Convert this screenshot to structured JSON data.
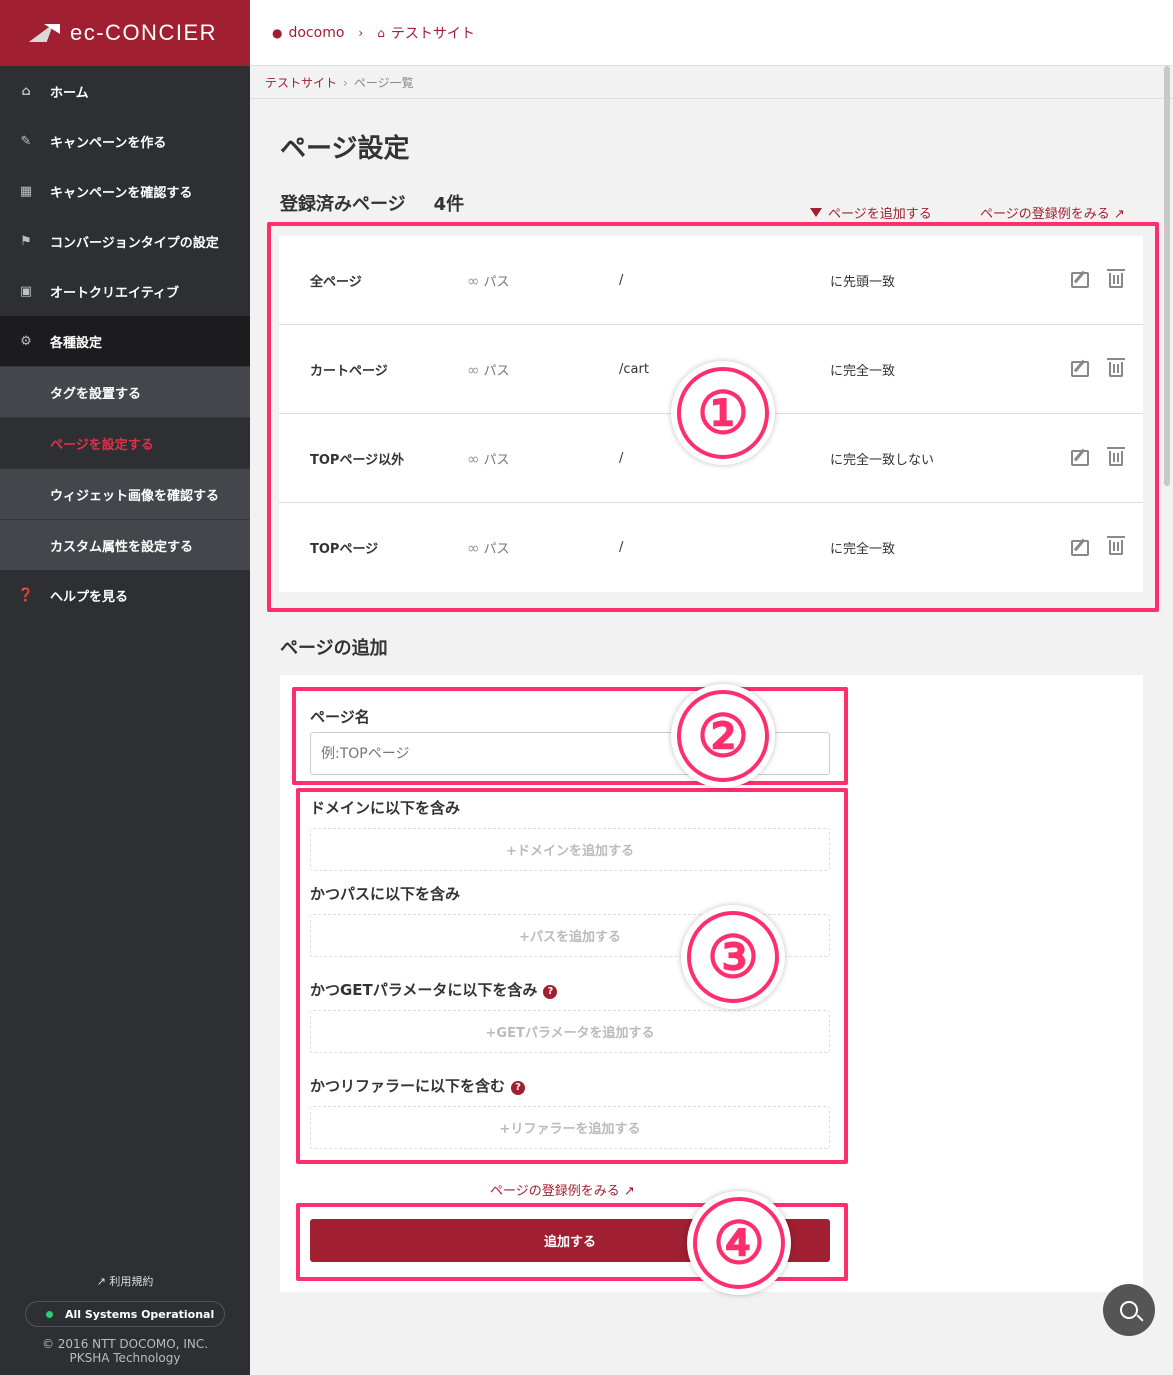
{
  "brand": {
    "logo_text": "ec-CONCIER"
  },
  "sidebar": {
    "items": [
      {
        "label": "ホーム",
        "icon": "home-icon"
      },
      {
        "label": "キャンペーンを作る",
        "icon": "edit-icon"
      },
      {
        "label": "キャンペーンを確認する",
        "icon": "bar-chart-icon"
      },
      {
        "label": "コンバージョンタイプの設定",
        "icon": "flag-icon"
      },
      {
        "label": "オートクリエイティブ",
        "icon": "image-icon"
      },
      {
        "label": "各種設定",
        "icon": "gear-icon"
      }
    ],
    "subitems": [
      {
        "label": "タグを設置する"
      },
      {
        "label": "ページを設定する"
      },
      {
        "label": "ウィジェット画像を確認する"
      },
      {
        "label": "カスタム属性を設定する"
      }
    ],
    "help": {
      "label": "ヘルプを見る",
      "icon": "question-icon"
    },
    "footer": {
      "terms": "利用規約",
      "status": "All Systems Operational",
      "copyright_1": "© 2016 NTT DOCOMO, INC.",
      "copyright_2": "PKSHA Technology"
    }
  },
  "topbar": {
    "user": "docomo",
    "site": "テストサイト"
  },
  "breadcrumb": {
    "parent": "テストサイト",
    "current": "ページ一覧"
  },
  "main": {
    "title": "ページ設定",
    "registered_title": "登録済みページ",
    "registered_count": "4件",
    "add_page_link": "ページを追加する",
    "examples_link": "ページの登録例をみる"
  },
  "pages": [
    {
      "name": "全ページ",
      "type": "パス",
      "value": "/",
      "match": "に先頭一致"
    },
    {
      "name": "カートページ",
      "type": "パス",
      "value": "/cart",
      "match": "に完全一致"
    },
    {
      "name": "TOPページ以外",
      "type": "パス",
      "value": "/",
      "match": "に完全一致しない"
    },
    {
      "name": "TOPページ",
      "type": "パス",
      "value": "/",
      "match": "に完全一致"
    }
  ],
  "add_form": {
    "title": "ページの追加",
    "page_name_label": "ページ名",
    "page_name_placeholder": "例:TOPページ",
    "domain_label": "ドメインに以下を含み",
    "domain_add": "+ドメインを追加する",
    "path_label": "かつパスに以下を含み",
    "path_add": "+パスを追加する",
    "get_label": "かつGETパラメータに以下を含み",
    "get_add": "+GETパラメータを追加する",
    "referrer_label": "かつリファラーに以下を含む",
    "referrer_add": "+リファラーを追加する",
    "examples_link": "ページの登録例をみる",
    "submit": "追加する"
  },
  "annotations": {
    "n1": "①",
    "n2": "②",
    "n3": "③",
    "n4": "④"
  },
  "colors": {
    "brand": "#a01f31",
    "annotation": "#ff2f6e",
    "sidebar": "#2e2f33"
  }
}
